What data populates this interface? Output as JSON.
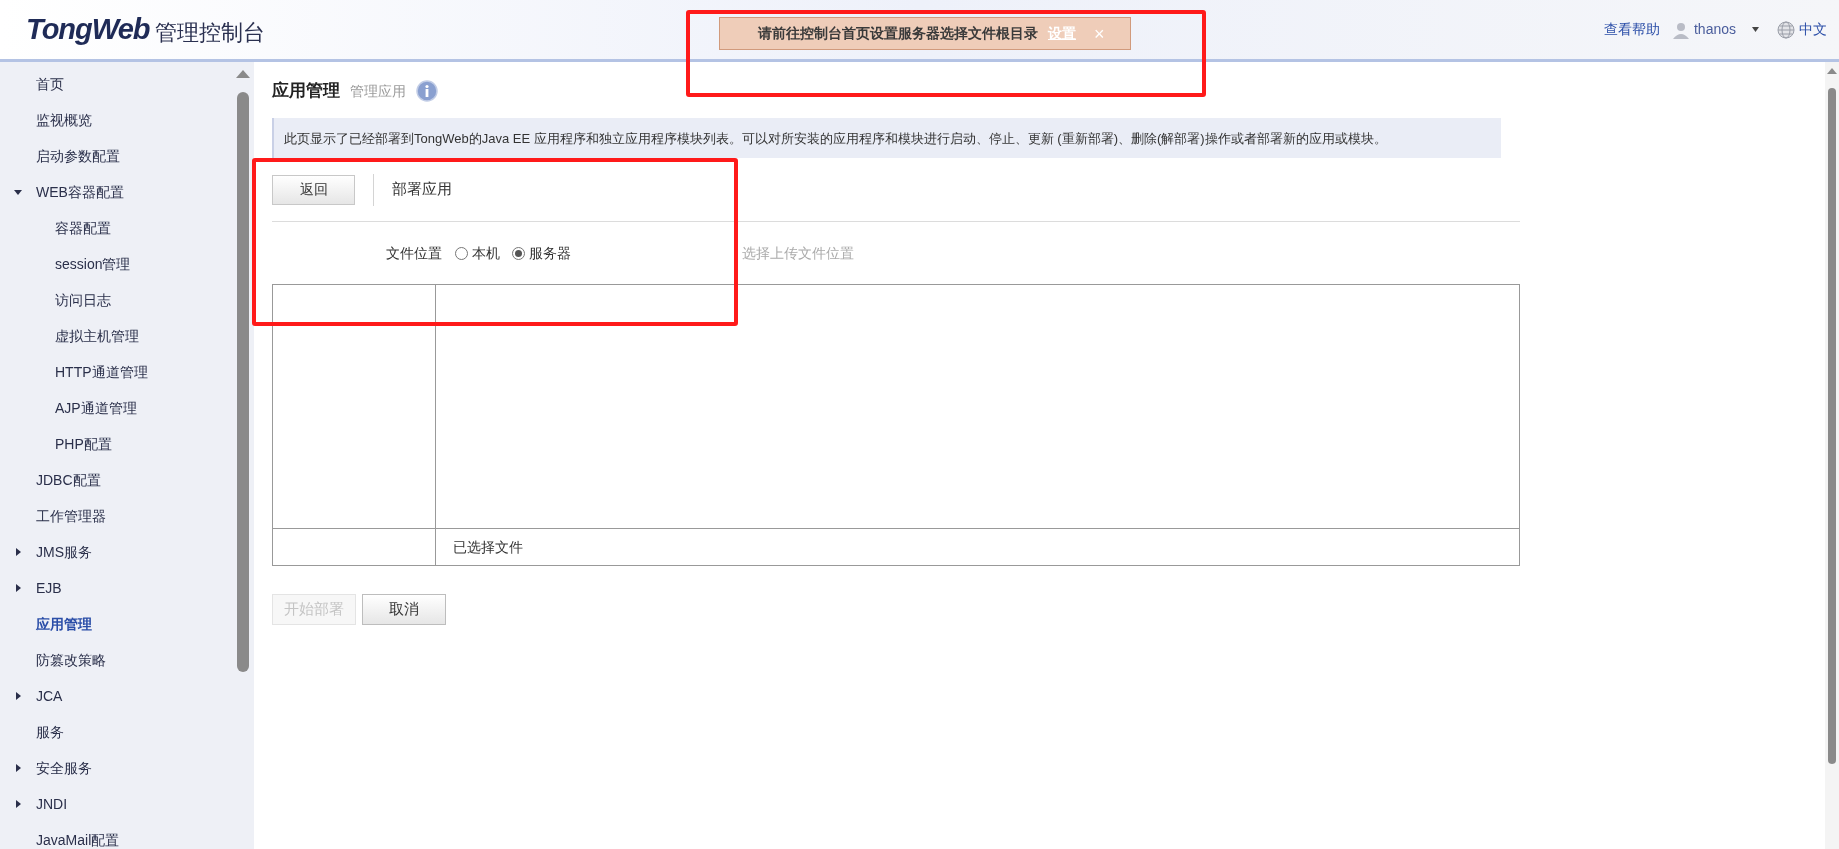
{
  "header": {
    "logo": "TongWeb",
    "product": "管理控制台",
    "notice": {
      "text": "请前往控制台首页设置服务器选择文件根目录",
      "link": "设置",
      "close": "×"
    },
    "help": "查看帮助",
    "user": "thanos",
    "language": "中文"
  },
  "sidebar": {
    "items": [
      {
        "label": "首页",
        "selected": false
      },
      {
        "label": "监视概览",
        "selected": false
      },
      {
        "label": "启动参数配置",
        "selected": false
      },
      {
        "label": "WEB容器配置",
        "selected": false,
        "expanded": true,
        "children": [
          {
            "label": "容器配置",
            "selected": false
          },
          {
            "label": "session管理",
            "selected": false
          },
          {
            "label": "访问日志",
            "selected": false
          },
          {
            "label": "虚拟主机管理",
            "selected": false
          },
          {
            "label": "HTTP通道管理",
            "selected": false
          },
          {
            "label": "AJP通道管理",
            "selected": false
          },
          {
            "label": "PHP配置",
            "selected": false
          }
        ]
      },
      {
        "label": "JDBC配置",
        "selected": false
      },
      {
        "label": "工作管理器",
        "selected": false
      },
      {
        "label": "JMS服务",
        "selected": false,
        "expanded": false
      },
      {
        "label": "EJB",
        "selected": false,
        "expanded": false
      },
      {
        "label": "应用管理",
        "selected": true
      },
      {
        "label": "防篡改策略",
        "selected": false
      },
      {
        "label": "JCA",
        "selected": false,
        "expanded": false
      },
      {
        "label": "服务",
        "selected": false
      },
      {
        "label": "安全服务",
        "selected": false,
        "expanded": false
      },
      {
        "label": "JNDI",
        "selected": false,
        "expanded": false
      },
      {
        "label": "JavaMail配置",
        "selected": false
      }
    ]
  },
  "page": {
    "title": "应用管理",
    "subtitle": "管理应用",
    "description": "此页显示了已经部署到TongWeb的Java EE 应用程序和独立应用程序模块列表。可以对所安装的应用程序和模块进行启动、停止、更新 (重新部署)、删除(解部署)操作或者部署新的应用或模块。",
    "back_button": "返回",
    "section_title": "部署应用",
    "file_location": {
      "label": "文件位置",
      "options": [
        {
          "label": "本机",
          "selected": false
        },
        {
          "label": "服务器",
          "selected": true
        }
      ],
      "hint": "选择上传文件位置"
    },
    "file_table": {
      "selected_label": "已选择文件"
    },
    "buttons": [
      {
        "label": "开始部署",
        "disabled": true
      },
      {
        "label": "取消",
        "disabled": false
      }
    ]
  }
}
